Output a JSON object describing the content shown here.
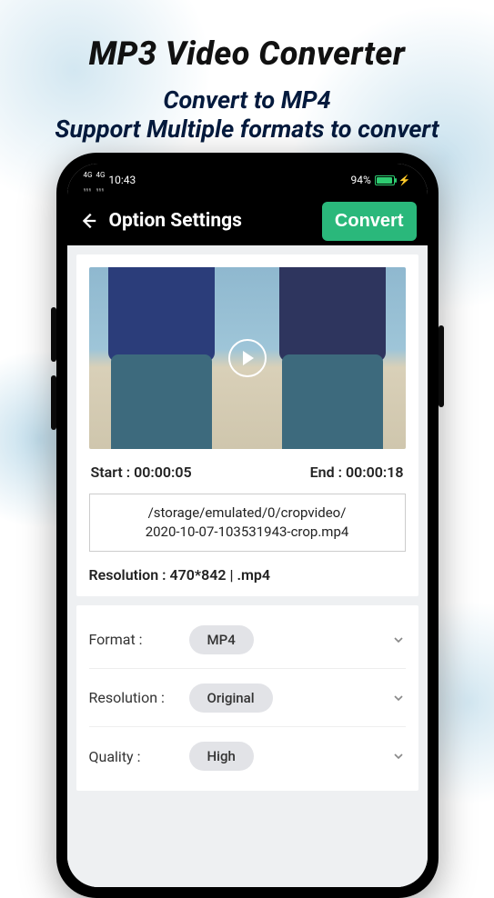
{
  "promo": {
    "title": "MP3 Video Converter",
    "subtitle_line1": "Convert to MP4",
    "subtitle_line2": "Support Multiple formats to convert"
  },
  "status": {
    "time": "10:43",
    "battery_percent": "94%"
  },
  "app_bar": {
    "title": "Option Settings",
    "convert_label": "Convert"
  },
  "video": {
    "start_label": "Start : 00:00:05",
    "end_label": "End : 00:00:18",
    "path_line1": "/storage/emulated/0/cropvideo/",
    "path_line2": "2020-10-07-103531943-crop.mp4",
    "resolution_line": "Resolution : 470*842 | .mp4"
  },
  "settings": {
    "format": {
      "label": "Format :",
      "value": "MP4"
    },
    "resolution": {
      "label": "Resolution :",
      "value": "Original"
    },
    "quality": {
      "label": "Quality :",
      "value": "High"
    }
  }
}
